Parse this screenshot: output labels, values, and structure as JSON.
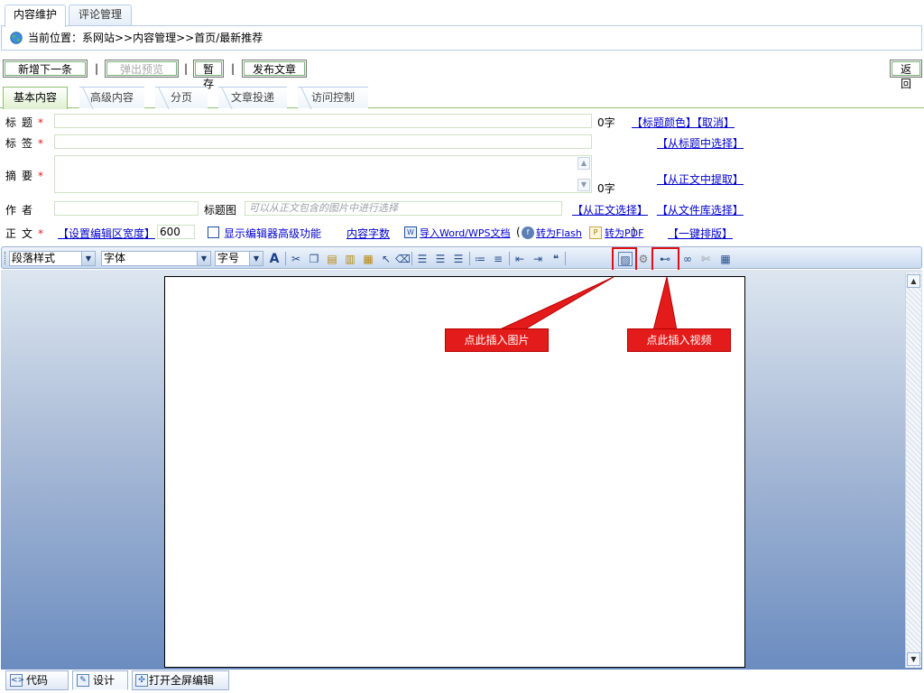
{
  "top_tabs": {
    "active": "内容维护",
    "inactive": "评论管理"
  },
  "breadcrumb": {
    "text": "当前位置：系网站>>内容管理>>首页/最新推荐"
  },
  "actions": {
    "new_next": "新增下一条",
    "popup_preview": "弹出预览",
    "save_draft": "暂存",
    "publish": "发布文章",
    "back": "返回",
    "separator": "|"
  },
  "content_tabs": [
    "基本内容",
    "高级内容",
    "分页",
    "文章投递",
    "访问控制"
  ],
  "form": {
    "required_mark": "*",
    "title": {
      "label": "标题",
      "count": "0字",
      "link_color": "【标题颜色】",
      "link_cancel": "【取消】"
    },
    "tags": {
      "label": "标签",
      "link": "【从标题中选择】"
    },
    "summary": {
      "label": "摘要",
      "count": "0字",
      "link": "【从正文中提取】"
    },
    "author": {
      "label": "作者",
      "thumb_label": "标题图",
      "thumb_placeholder": "可以从正文包含的图片中进行选择",
      "link_from_body": "【从正文选择】",
      "link_from_library": "【从文件库选择】"
    },
    "body": {
      "label": "正文",
      "set_width": "【设置编辑区宽度】",
      "width_value": "600",
      "show_advanced": "显示编辑器高级功能",
      "word_count": "内容字数",
      "import_word": "导入Word/WPS文档",
      "to_flash": "转为Flash",
      "to_pdf": "转为PDF",
      "one_click_layout": "【一键排版】"
    }
  },
  "toolbar": {
    "paragraph_style": "段落样式",
    "font": "字体",
    "font_size": "字号"
  },
  "callouts": {
    "insert_image": "点此插入图片",
    "insert_video": "点此插入视频",
    "color": "#e31b1b"
  },
  "mode_tabs": {
    "code": "代码",
    "design": "设计",
    "fullscreen": "打开全屏编辑"
  }
}
